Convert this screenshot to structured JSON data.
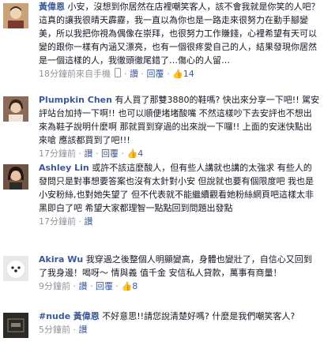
{
  "comments": [
    {
      "author": "黃偉恩",
      "text": "小安，沒想到你居然在店裡嘲笑客人，該不會我就是你笑的人吧？這真的讓我很晴天霹靂，我一直以為你也是一路走來很努力在勤手腳變美，所以我把你視為偶像在崇拜，也很努力工作賺錢，心裡希望有天可以變的跟你一樣有內涵又漂亮，也有一個很疼愛自己的人，結果發現你居然是一個這樣的人，我徹頭徹尾錯了…傷心的人留…",
      "time": "18分鐘前來自手機",
      "via_icon": "mobile-icon",
      "actions": [
        "讚",
        "回覆"
      ],
      "like_count": "14",
      "avatar_bg": "#c9a27a"
    },
    {
      "author": "Plumpkin Chen",
      "text": "有人買了那雙3880的鞋嗎? 快出來分享一下吧!! 駕安評站台加持一下啊!! 也可以順便堵堵酸嘴 不然這樣吵下去安評也不想出來為鞋子說明什麼啊 那就買到穿過的出來說一下囉!! 上面的安迷快點出來嗆 應該都買到了吧!!!",
      "time": "17分鐘前",
      "actions": [
        "讚",
        "回覆"
      ],
      "like_count": "4",
      "avatar_bg": "#8a6b5a"
    },
    {
      "author": "Ashley Lin",
      "text": "或許不該這麼酸人，但有些人講就也講的太強求 有些人的發問只是對事想要答案也沒有太針對小安 但說就也要有個限度吧 我也是小安粉絲,也對她失望了 但不代表就不能繼續觀看她粉絲網頁吧這樣太非黑即白了吧 希望大家都理智一點點回到問題出發點",
      "time": "17分鐘前",
      "actions": [
        "讚"
      ],
      "avatar_bg": "#6e5244"
    },
    {
      "author": "Akira Wu",
      "text": "我穿過之後整個人明顯變高，身體也變壯了，自信心又回到了我身邊！喝呀～ 情與義 值千金 安信私人貸款，萬事有商量！",
      "time": "9分鐘前",
      "actions": [
        "讚",
        "回覆"
      ],
      "like_count": "8",
      "avatar_bg": "#d8d8d8"
    },
    {
      "hashtag": "#nude",
      "author": "黃偉恩",
      "text": "不好意思!!請您說清楚好嗎? 什麼是我們嘲笑客人?",
      "time": "5分鐘前",
      "actions": [
        "讚"
      ],
      "avatar_bg": "#2c2a24"
    }
  ]
}
